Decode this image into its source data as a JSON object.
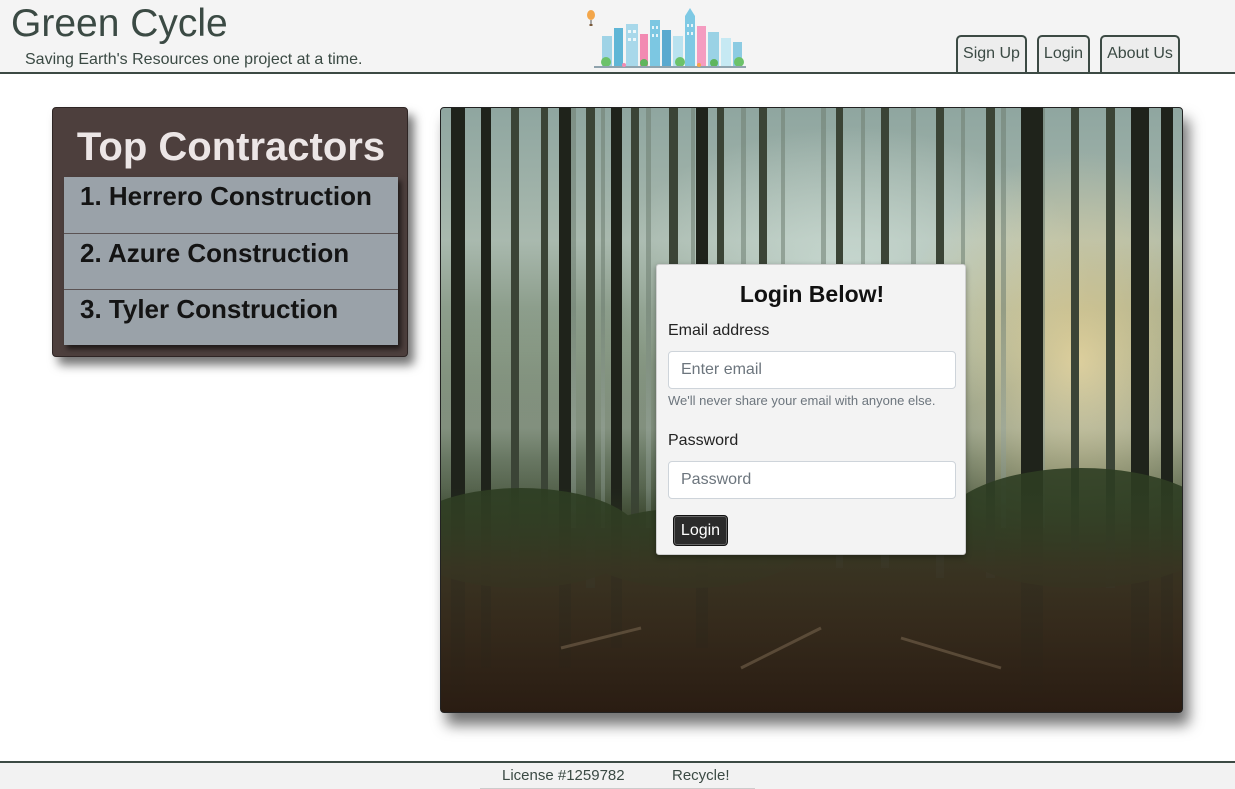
{
  "header": {
    "title": "Green Cycle",
    "tagline": "Saving Earth's Resources one project at a time.",
    "logo_icon": "city-skyline-logo"
  },
  "nav": {
    "signup": "Sign Up",
    "login": "Login",
    "about": "About Us"
  },
  "contractors": {
    "title": "Top Contractors",
    "items": [
      "1. Herrero Construction",
      "2. Azure Construction",
      "3. Tyler Construction"
    ]
  },
  "login_form": {
    "title": "Login Below!",
    "email_label": "Email address",
    "email_placeholder": "Enter email",
    "email_help": "We'll never share your email with anyone else.",
    "password_label": "Password",
    "password_placeholder": "Password",
    "submit": "Login"
  },
  "footer": {
    "license": "License #1259782",
    "recycle": "Recycle!"
  },
  "colors": {
    "header_bg": "#f4f4f4",
    "brand_text": "#3b4a44",
    "panel_bg": "#4d3f3d",
    "list_item_bg": "#9aa2a9",
    "button_dark": "#2b2b2b"
  }
}
